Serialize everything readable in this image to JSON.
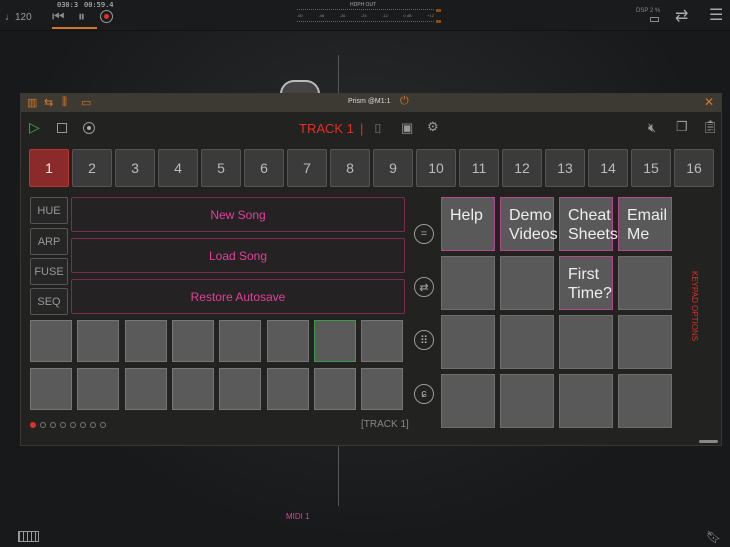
{
  "topbar": {
    "tempo": "♩120",
    "position": "030:3",
    "time": "00:59.4",
    "meter_label": "HDPH OUT",
    "meter_ticks": [
      "-60",
      "-48",
      "-36",
      "-24",
      "-12",
      "0 dB",
      "+12"
    ],
    "dsp": "DSP 2 %"
  },
  "plugin": {
    "title": "Prism @M1:1",
    "track_label": "TRACK 1",
    "separator": "|",
    "tracks": [
      "1",
      "2",
      "3",
      "4",
      "5",
      "6",
      "7",
      "8",
      "9",
      "10",
      "11",
      "12",
      "13",
      "14",
      "15",
      "16"
    ],
    "selected_track": "1",
    "side_buttons": [
      "HUE",
      "ARP",
      "FUSE",
      "SEQ"
    ],
    "song_buttons": [
      "New Song",
      "Load Song",
      "Restore Autosave"
    ],
    "keypad": [
      "Help",
      "Demo Videos",
      "Cheat Sheets",
      "Email Me",
      "",
      "",
      "First Time?",
      "",
      "",
      "",
      "",
      "",
      "",
      "",
      "",
      ""
    ],
    "keypad_options": "KEYPAD OPTIONS",
    "footer_track": "[TRACK 1]"
  },
  "bottom": {
    "midi_label": "MIDI 1"
  },
  "colors": {
    "accent_red": "#e0302a",
    "pink": "#e0409a",
    "orange": "#d0782a",
    "green": "#3cb94a"
  }
}
